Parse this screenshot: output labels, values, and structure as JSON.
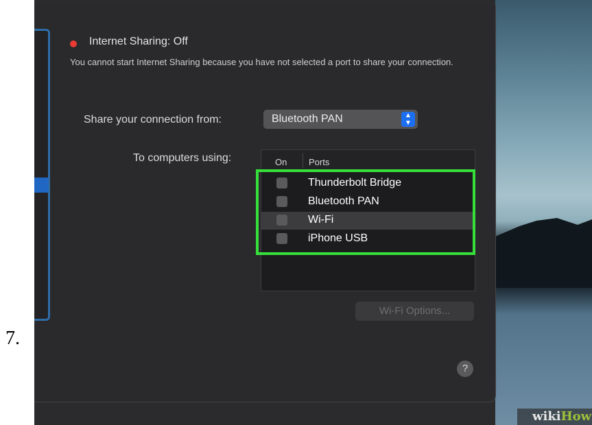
{
  "step": {
    "number": "7."
  },
  "sharing": {
    "title": "Internet Sharing: Off",
    "status_color": "#ec3b34",
    "description": "You cannot start Internet Sharing because you have not selected a port to share your connection."
  },
  "share_from": {
    "label": "Share your connection from:",
    "selected": "Bluetooth PAN"
  },
  "to_computers": {
    "label": "To computers using:"
  },
  "ports_table": {
    "columns": [
      "On",
      "Ports"
    ],
    "rows": [
      {
        "name": "Thunderbolt Bridge",
        "checked": false
      },
      {
        "name": "Bluetooth PAN",
        "checked": false
      },
      {
        "name": "Wi-Fi",
        "checked": false
      },
      {
        "name": "iPhone USB",
        "checked": false
      }
    ]
  },
  "buttons": {
    "wifi_options": "Wi-Fi Options...",
    "help": "?"
  },
  "watermark": {
    "part1": "wiki",
    "part2": "How"
  },
  "colors": {
    "highlight_box": "#36e03a",
    "accent": "#1d6ff2"
  }
}
